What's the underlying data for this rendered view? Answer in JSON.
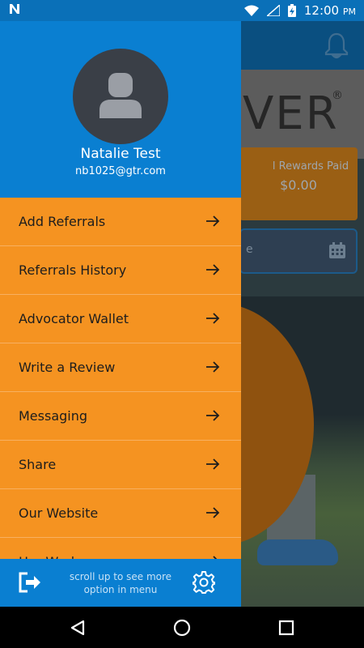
{
  "status_bar": {
    "notification_icon": "n-letter-icon",
    "time": "12:00",
    "time_suffix": "PM"
  },
  "background": {
    "logo_text": "VER",
    "logo_mark": "®",
    "rewards_label": "l Rewards Paid",
    "rewards_value": "$0.00",
    "date_field_letter": "e"
  },
  "drawer": {
    "user": {
      "name": "Natalie Test",
      "email": "nb1025@gtr.com"
    },
    "menu": [
      {
        "label": "Add Referrals"
      },
      {
        "label": "Referrals History"
      },
      {
        "label": "Advocator Wallet"
      },
      {
        "label": "Write a Review"
      },
      {
        "label": "Messaging"
      },
      {
        "label": "Share"
      },
      {
        "label": "Our Website"
      },
      {
        "label": "Her Work"
      }
    ],
    "footer": {
      "hint_line1": "scroll up to see more",
      "hint_line2": "option in menu"
    }
  },
  "colors": {
    "drawer_blue": "#0a7fd1",
    "menu_orange": "#f59321",
    "avatar_bg": "#3a3f47"
  }
}
